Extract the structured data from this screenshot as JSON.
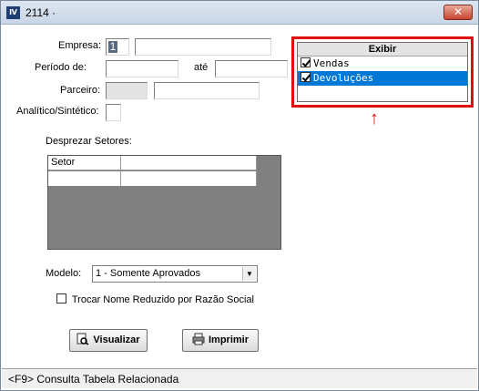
{
  "window": {
    "title": "2114 ·",
    "close_label": "✕"
  },
  "form": {
    "empresa_label": "Empresa:",
    "empresa_code": "1",
    "empresa_name": "",
    "periodo_label": "Período de:",
    "periodo_from": "",
    "ate_label": "até",
    "periodo_to": "",
    "parceiro_label": "Parceiro:",
    "parceiro_code": "",
    "parceiro_name": "",
    "analitico_label": "Analítico/Sintético:",
    "analitico_value": ""
  },
  "exibir": {
    "title": "Exibir",
    "items": [
      {
        "label": "Vendas",
        "checked": true,
        "selected": false
      },
      {
        "label": "Devoluções",
        "checked": true,
        "selected": true
      }
    ],
    "highlight_color": "#e01010"
  },
  "annotation_arrow": "↑",
  "setores": {
    "label": "Desprezar Setores:",
    "columns": [
      "Setor",
      ""
    ],
    "rows": [
      [
        "",
        ""
      ]
    ]
  },
  "modelo": {
    "label": "Modelo:",
    "selected": "1 - Somente Aprovados"
  },
  "trocar_nome": {
    "label": "Trocar Nome Reduzido por Razão Social",
    "checked": false
  },
  "buttons": {
    "visualizar": "Visualizar",
    "imprimir": "Imprimir"
  },
  "status": "<F9> Consulta Tabela Relacionada",
  "colors": {
    "selection": "#0078d7",
    "grid_bg": "#808080"
  }
}
